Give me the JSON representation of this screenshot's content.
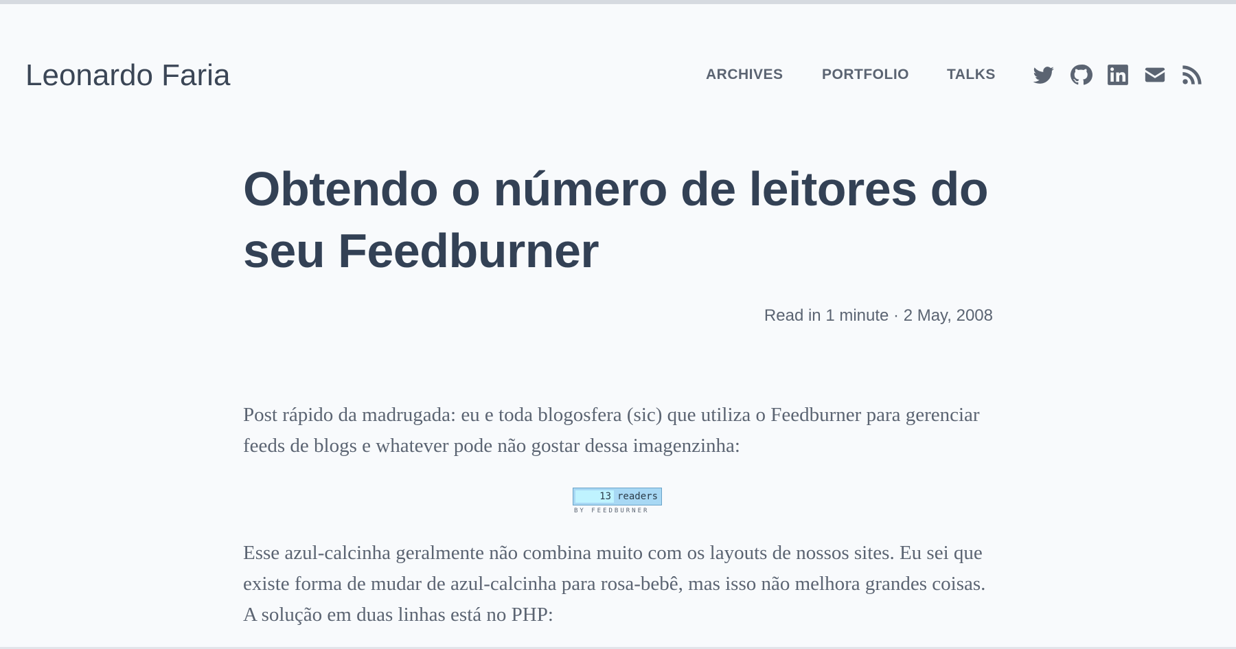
{
  "header": {
    "site_title": "Leonardo Faria",
    "nav": [
      {
        "label": "ARCHIVES"
      },
      {
        "label": "PORTFOLIO"
      },
      {
        "label": "TALKS"
      }
    ],
    "social_icons": [
      "twitter-icon",
      "github-icon",
      "linkedin-icon",
      "email-icon",
      "rss-icon"
    ]
  },
  "post": {
    "title_line1": "Obtendo o número de leitores do",
    "title_line2": "seu Feedburner",
    "meta": "Read in 1 minute · 2 May, 2008",
    "paragraph1": "Post rápido da madrugada: eu e toda blogosfera (sic) que utiliza o Feedburner para gerenciar feeds de blogs e whatever pode não gostar dessa imagenzinha:",
    "feedburner": {
      "count": "13",
      "label": "readers",
      "byline": "BY FEEDBURNER"
    },
    "paragraph2": "Esse azul-calcinha geralmente não combina muito com os layouts de nossos sites. Eu sei que existe forma de mudar de azul-calcinha para rosa-bebê, mas isso não melhora grandes coisas. A solução em duas linhas está no PHP:"
  },
  "colors": {
    "background": "#f8fafc",
    "title_text": "#334155",
    "muted_text": "#5b6472",
    "feedburner_blue": "#a8d8f4"
  }
}
